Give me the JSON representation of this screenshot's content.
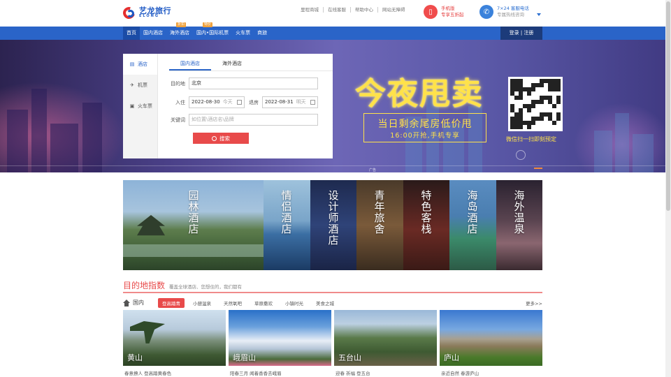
{
  "header": {
    "logo_cn": "艺龙旅行",
    "logo_en": "ELONG",
    "top_links": [
      "里程商城",
      "在线客服",
      "帮助中心",
      "网站无障碍"
    ],
    "mobile_promo": {
      "line1": "手机版",
      "line2": "专享五折起"
    },
    "phone_promo": {
      "line1": "7×24 客服电话",
      "line2": "专属热线咨询"
    }
  },
  "nav": {
    "items": [
      {
        "label": "首页",
        "tag": ""
      },
      {
        "label": "国内酒店",
        "tag": ""
      },
      {
        "label": "海外酒店",
        "tag": "折扣"
      },
      {
        "label": "国内•国际机票",
        "tag": "特价"
      },
      {
        "label": "火车票",
        "tag": ""
      },
      {
        "label": "商旅",
        "tag": ""
      }
    ],
    "login": "登录 | 注册"
  },
  "search": {
    "side_tabs": [
      "酒店",
      "机票",
      "火车票"
    ],
    "tabs": [
      "国内酒店",
      "海外酒店"
    ],
    "destination_label": "目的地",
    "destination_value": "北京",
    "checkin_label": "入住",
    "checkin_value": "2022-08-30",
    "checkin_hint": "今天",
    "checkout_label": "退房",
    "checkout_value": "2022-08-31",
    "checkout_hint": "明天",
    "keyword_label": "关键词",
    "keyword_placeholder": "如位置\\酒店名\\品牌",
    "button": "搜索"
  },
  "banner": {
    "title": "今夜甩卖",
    "subtitle": "当日剩余尾房低价甩",
    "sub2": "16:00开抢,手机专享",
    "qr_caption": "微信扫一扫即刻预定",
    "ad_tag": "广告"
  },
  "themes": [
    "园林酒店",
    "情侣酒店",
    "设计师酒店",
    "青年旅舍",
    "特色客栈",
    "海岛酒店",
    "海外温泉"
  ],
  "destinations": {
    "title": "目的地指数",
    "subtitle": "覆盖全球酒店、您想住的，我们都有",
    "region": "国内",
    "categories": [
      "登高踏青",
      "小憩温泉",
      "天然氧吧",
      "草原撒欢",
      "小镇时光",
      "美食之城"
    ],
    "more": "更多>>",
    "cards": [
      {
        "name": "黄山",
        "desc": "春意撩人 登高踏黄春色"
      },
      {
        "name": "峨眉山",
        "desc": "阳春三月 闻着香香去峨眉"
      },
      {
        "name": "五台山",
        "desc": "迎春 祈福 登五台"
      },
      {
        "name": "庐山",
        "desc": "亲近自然 春游庐山"
      }
    ]
  },
  "colors": {
    "brand_blue": "#2a64c8",
    "accent_red": "#e84a4a",
    "banner_yellow": "#ffe24a"
  }
}
